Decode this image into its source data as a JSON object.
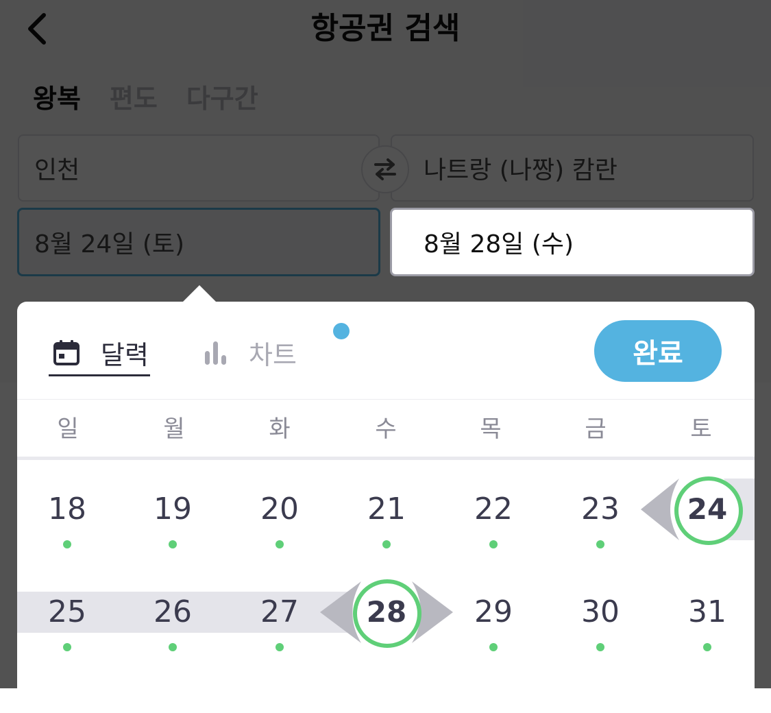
{
  "header": {
    "title": "항공권 검색"
  },
  "trip_types": [
    {
      "label": "왕복",
      "active": true
    },
    {
      "label": "편도",
      "active": false
    },
    {
      "label": "다구간",
      "active": false
    }
  ],
  "route": {
    "from": "인천",
    "to": "나트랑 (나짱) 캄란"
  },
  "dates": {
    "depart": "8월 24일 (토)",
    "return": "8월 28일 (수)"
  },
  "picker": {
    "tabs": [
      {
        "label": "달력",
        "icon": "calendar-icon",
        "active": true
      },
      {
        "label": "차트",
        "icon": "bar-chart-icon",
        "active": false
      }
    ],
    "done_label": "완료",
    "weekdays": [
      "일",
      "월",
      "화",
      "수",
      "목",
      "금",
      "토"
    ],
    "weeks": [
      [
        "18",
        "19",
        "20",
        "21",
        "22",
        "23",
        "24"
      ],
      [
        "25",
        "26",
        "27",
        "28",
        "29",
        "30",
        "31"
      ]
    ],
    "selected_start": "24",
    "selected_end": "28"
  },
  "colors": {
    "accent": "#54b3e0",
    "selection_ring": "#5fcf78",
    "range_band": "#e4e4ea",
    "text_dark": "#3b3b4e"
  }
}
